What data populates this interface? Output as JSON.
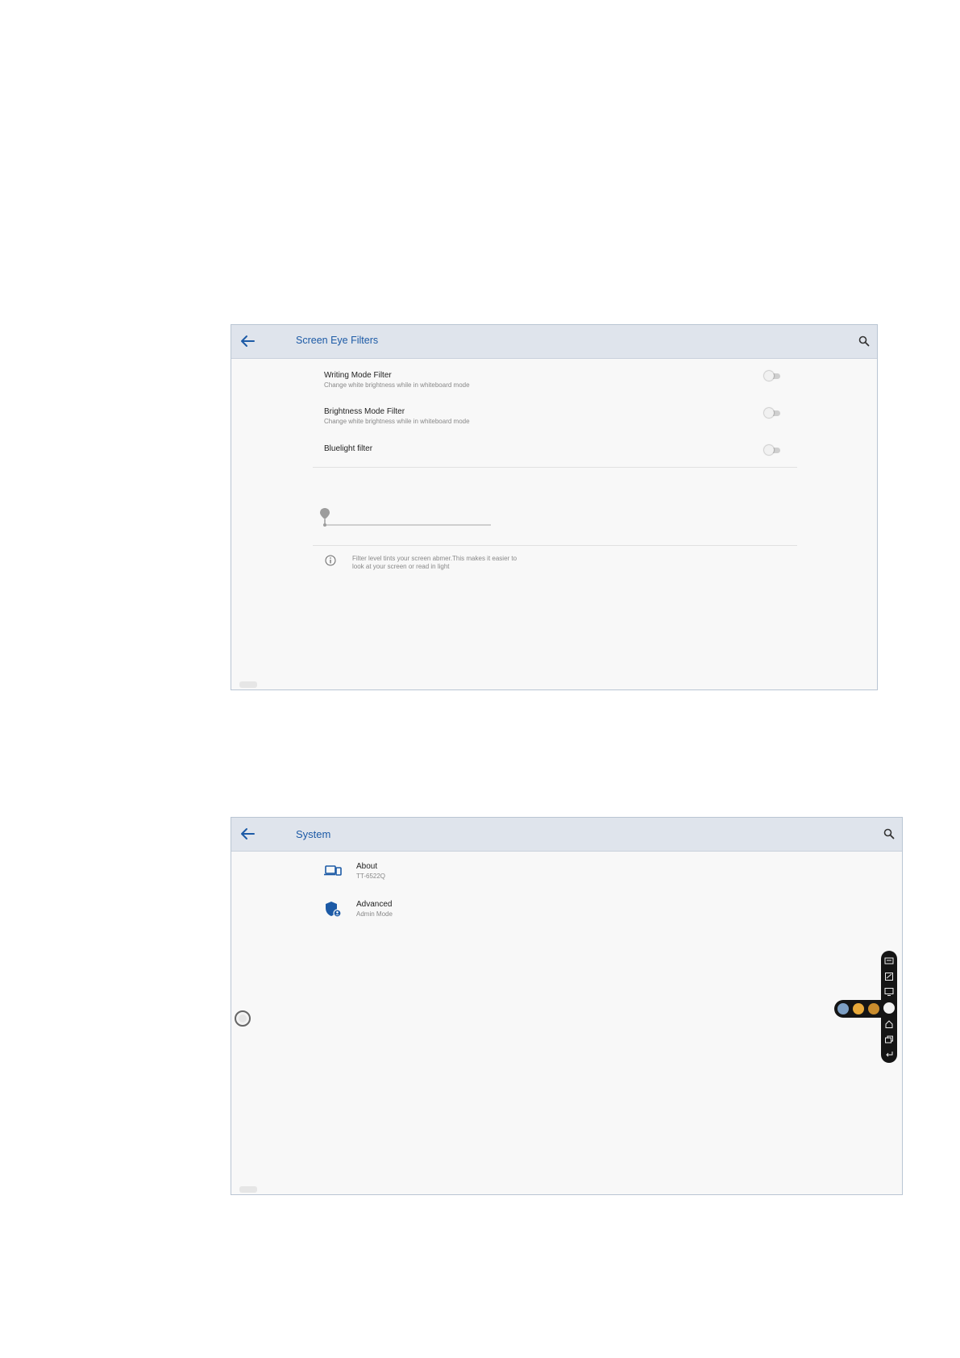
{
  "screens": [
    {
      "title": "Screen Eye Filters",
      "icons": {
        "back": "arrow-left-icon",
        "search": "search-icon"
      },
      "settings": [
        {
          "title": "Writing Mode Filter",
          "subtitle": "Change white brightness while in whiteboard mode",
          "enabled": false
        },
        {
          "title": "Brightness Mode Filter",
          "subtitle": "Change white brightness while in whiteboard mode",
          "enabled": false
        },
        {
          "title": "Bluelight filter",
          "subtitle": "",
          "enabled": false
        }
      ],
      "filter_level": 0,
      "info": {
        "icon": "info-circle-icon",
        "line1": "Filter level tints your screen abmer.This makes it easier to",
        "line2": "look at your screen or read in light"
      }
    },
    {
      "title": "System",
      "icons": {
        "back": "arrow-left-icon",
        "search": "search-icon"
      },
      "items": [
        {
          "title": "About",
          "subtitle": "TT-6522Q",
          "icon": "devices-icon"
        },
        {
          "title": "Advanced",
          "subtitle": "Admin Mode",
          "icon": "admin-shield-icon"
        }
      ],
      "floating_toolbar": {
        "side_buttons": [
          "annotate-icon",
          "whiteboard-icon",
          "screen-share-icon",
          "home-icon",
          "windows-icon",
          "back-icon"
        ],
        "apps": [
          "gallery-app-icon",
          "calendar-app-icon",
          "settings-app-icon"
        ]
      }
    }
  ],
  "colors": {
    "accent": "#1c5aa6",
    "appbar": "#dfe4ec",
    "background": "#f8f8f8",
    "toolbar": "#151515",
    "app_icon": "#e8a93a"
  }
}
